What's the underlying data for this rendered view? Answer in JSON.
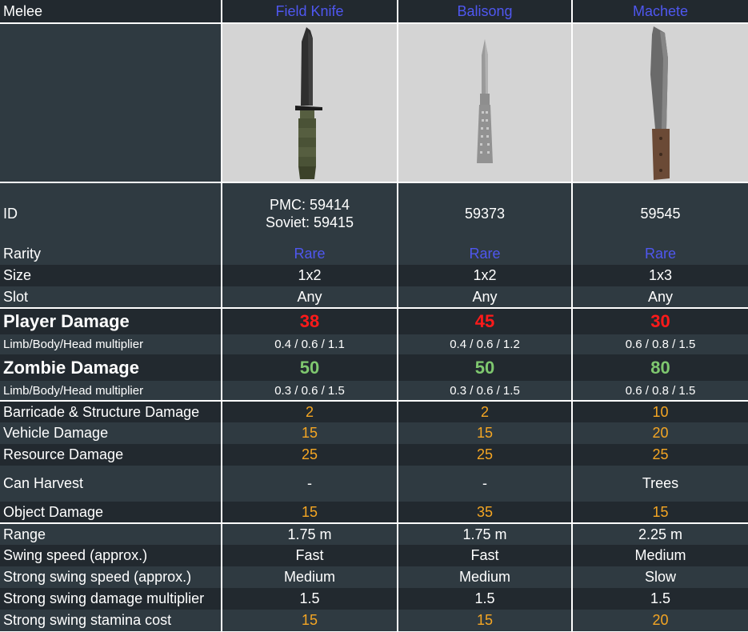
{
  "header": {
    "category": "Melee",
    "items": [
      "Field Knife",
      "Balisong",
      "Machete"
    ]
  },
  "images": [
    {
      "icon": "field-knife-icon"
    },
    {
      "icon": "balisong-icon"
    },
    {
      "icon": "machete-icon"
    }
  ],
  "colors": {
    "header_bg": "#22292f",
    "row_dark": "#22292f",
    "row_light": "#2f3a41",
    "image_bg": "#d4d4d4",
    "rare": "#4f57f0",
    "player_damage": "#ff1a1a",
    "zombie_damage": "#7fc86f",
    "orange_stat": "#f5a623"
  },
  "rows": {
    "id": {
      "label": "ID",
      "values": [
        [
          "PMC: 59414",
          "Soviet: 59415"
        ],
        [
          "59373"
        ],
        [
          "59545"
        ]
      ]
    },
    "rarity": {
      "label": "Rarity",
      "values": [
        "Rare",
        "Rare",
        "Rare"
      ]
    },
    "size": {
      "label": "Size",
      "values": [
        "1x2",
        "1x2",
        "1x3"
      ]
    },
    "slot": {
      "label": "Slot",
      "values": [
        "Any",
        "Any",
        "Any"
      ]
    },
    "player_damage": {
      "label": "Player Damage",
      "values": [
        "38",
        "45",
        "30"
      ]
    },
    "player_mult": {
      "label": "Limb/Body/Head multiplier",
      "values": [
        "0.4 / 0.6 / 1.1",
        "0.4 / 0.6 / 1.2",
        "0.6 / 0.8 / 1.5"
      ]
    },
    "zombie_damage": {
      "label": "Zombie Damage",
      "values": [
        "50",
        "50",
        "80"
      ]
    },
    "zombie_mult": {
      "label": "Limb/Body/Head multiplier",
      "values": [
        "0.3 / 0.6 / 1.5",
        "0.3 / 0.6 / 1.5",
        "0.6 / 0.8 / 1.5"
      ]
    },
    "barricade": {
      "label": "Barricade & Structure Damage",
      "values": [
        "2",
        "2",
        "10"
      ]
    },
    "vehicle": {
      "label": "Vehicle Damage",
      "values": [
        "15",
        "15",
        "20"
      ]
    },
    "resource": {
      "label": "Resource Damage",
      "values": [
        "25",
        "25",
        "25"
      ]
    },
    "harvest": {
      "label": "Can Harvest",
      "values": [
        "-",
        "-",
        "Trees"
      ]
    },
    "object": {
      "label": "Object Damage",
      "values": [
        "15",
        "35",
        "15"
      ]
    },
    "range": {
      "label": "Range",
      "values": [
        "1.75 m",
        "1.75 m",
        "2.25 m"
      ]
    },
    "swing": {
      "label": "Swing speed (approx.)",
      "values": [
        "Fast",
        "Fast",
        "Medium"
      ]
    },
    "strong_swing": {
      "label": "Strong swing speed (approx.)",
      "values": [
        "Medium",
        "Medium",
        "Slow"
      ]
    },
    "strong_mult": {
      "label": "Strong swing damage multiplier",
      "values": [
        "1.5",
        "1.5",
        "1.5"
      ]
    },
    "stamina": {
      "label": "Strong swing stamina cost",
      "values": [
        "15",
        "15",
        "20"
      ]
    }
  }
}
